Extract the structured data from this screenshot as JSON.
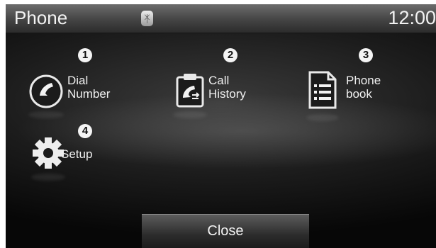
{
  "status_bar": {
    "title": "Phone",
    "bluetooth_icon": "bluetooth-icon",
    "clock": "12:00"
  },
  "menu": {
    "items": [
      {
        "number": "1",
        "line1": "Dial",
        "line2": "Number",
        "icon": "dial-handset-icon"
      },
      {
        "number": "2",
        "line1": "Call",
        "line2": "History",
        "icon": "call-history-icon"
      },
      {
        "number": "3",
        "line1": "Phone",
        "line2": "book",
        "icon": "phonebook-icon"
      },
      {
        "number": "4",
        "line1": "Setup",
        "icon": "gear-icon"
      }
    ]
  },
  "footer": {
    "close_label": "Close"
  }
}
